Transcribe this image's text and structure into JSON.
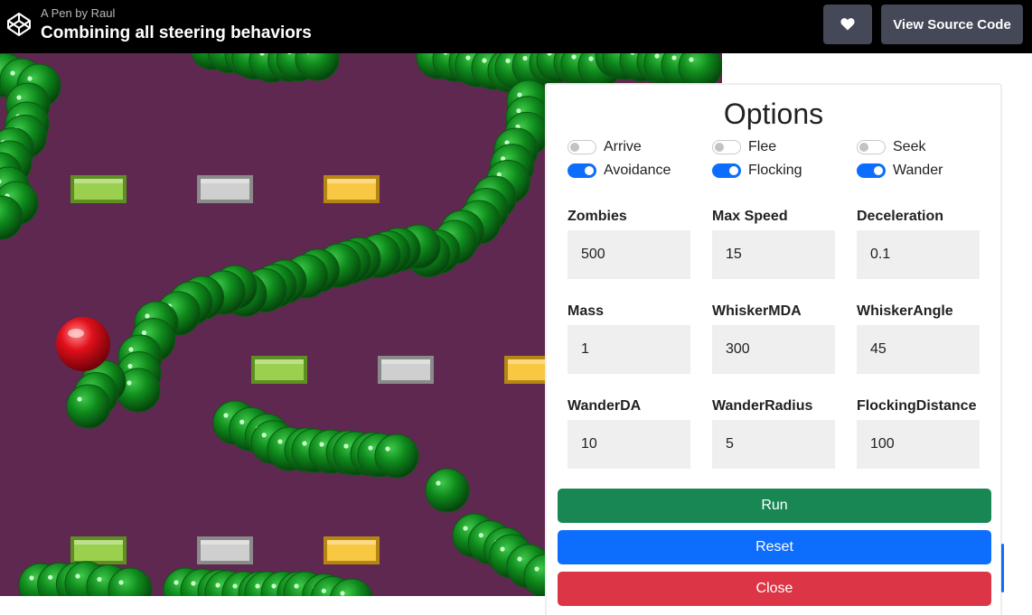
{
  "header": {
    "byline": "A Pen by Raul",
    "title": "Combining all steering behaviors",
    "view_source_label": "View Source Code",
    "logo_icon": "codepen-icon",
    "heart_icon": "heart-icon"
  },
  "colors": {
    "background": "#5e2850",
    "zombie": "#0b7a17",
    "player": "#e0101a",
    "run": "#198754",
    "reset": "#0d6efd",
    "close": "#dc3545"
  },
  "options": {
    "title": "Options",
    "toggles": [
      {
        "label": "Arrive",
        "on": false
      },
      {
        "label": "Flee",
        "on": false
      },
      {
        "label": "Seek",
        "on": false
      },
      {
        "label": "Avoidance",
        "on": true
      },
      {
        "label": "Flocking",
        "on": true
      },
      {
        "label": "Wander",
        "on": true
      }
    ],
    "fields": [
      {
        "label": "Zombies",
        "value": "500"
      },
      {
        "label": "Max Speed",
        "value": "15"
      },
      {
        "label": "Deceleration",
        "value": "0.1"
      },
      {
        "label": "Mass",
        "value": "1"
      },
      {
        "label": "WhiskerMDA",
        "value": "300"
      },
      {
        "label": "WhiskerAngle",
        "value": "45"
      },
      {
        "label": "WanderDA",
        "value": "10"
      },
      {
        "label": "WanderRadius",
        "value": "5"
      },
      {
        "label": "FlockingDistance",
        "value": "100"
      }
    ],
    "run_label": "Run",
    "reset_label": "Reset",
    "close_label": "Close"
  }
}
